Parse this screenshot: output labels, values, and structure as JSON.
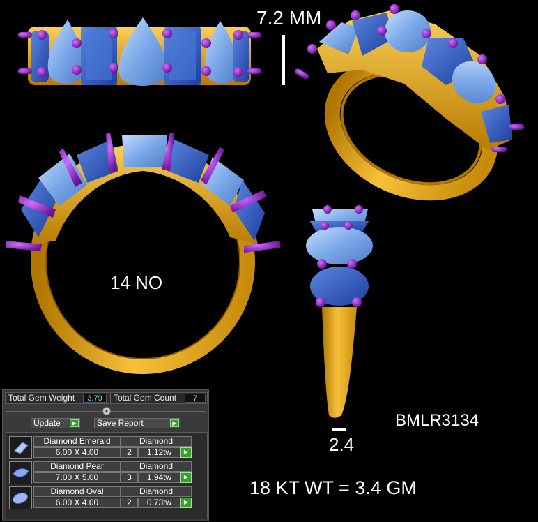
{
  "annotations": {
    "height_dimension": "7.2 MM",
    "ring_size": "14 NO",
    "shank_width": "2.4",
    "design_code": "BMLR3134",
    "metal_weight": "18 KT WT = 3.4 GM"
  },
  "gem_report": {
    "total_weight_label": "Total Gem Weight",
    "total_weight_value": "3.79",
    "total_count_label": "Total Gem Count",
    "total_count_value": "7",
    "update_label": "Update",
    "save_report_label": "Save Report",
    "go_glyph": "▶",
    "rows": [
      {
        "name": "Diamond Emerald",
        "material": "Diamond",
        "size": "6.00 X 4.00",
        "count": "2",
        "weight": "1.12tw",
        "icon": "emerald-gem-icon"
      },
      {
        "name": "Diamond Pear",
        "material": "Diamond",
        "size": "7.00 X 5.00",
        "count": "3",
        "weight": "1.94tw",
        "icon": "pear-gem-icon"
      },
      {
        "name": "Diamond Oval",
        "material": "Diamond",
        "size": "6.00 X 4.00",
        "count": "2",
        "weight": "0.73tw",
        "icon": "oval-gem-icon"
      }
    ]
  },
  "colors": {
    "background": "#000000",
    "metal_gold": "#f2b424",
    "prong_purple": "#8a1fb8",
    "gem_light_blue": "#7aa8e8",
    "gem_dark_blue": "#2850c8",
    "go_green": "#37a02a",
    "value_blue": "#7ecfff"
  }
}
